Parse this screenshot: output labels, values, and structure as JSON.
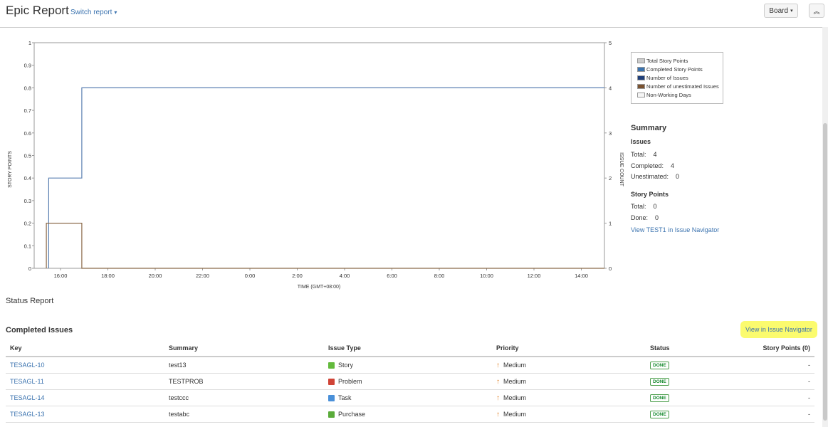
{
  "header": {
    "title": "Epic Report",
    "switch_report": "Switch report",
    "board_button": "Board",
    "collapse_icon": "double-chevron-up"
  },
  "chart_data": {
    "type": "line",
    "xlabel": "TIME (GMT+08:00)",
    "ylabel": "STORY POINTS",
    "y2label": "ISSUE COUNT",
    "x_ticks": [
      "16:00",
      "18:00",
      "20:00",
      "22:00",
      "0:00",
      "2:00",
      "4:00",
      "6:00",
      "8:00",
      "10:00",
      "12:00",
      "14:00"
    ],
    "y_ticks": [
      "0",
      "0.1",
      "0.2",
      "0.3",
      "0.4",
      "0.5",
      "0.6",
      "0.7",
      "0.8",
      "0.9",
      "1"
    ],
    "y2_ticks": [
      "0",
      "1",
      "2",
      "3",
      "4",
      "5"
    ],
    "ylim": [
      0,
      1
    ],
    "y2lim": [
      0,
      5
    ],
    "x_range_hours": [
      15,
      15.75
    ],
    "grid": false,
    "legend_placement": "right",
    "series": [
      {
        "name": "Number of Issues",
        "axis": "right",
        "color": "#5b80b2",
        "points": [
          [
            15.5,
            0
          ],
          [
            15.5,
            2
          ],
          [
            16.9,
            2
          ],
          [
            16.9,
            4
          ],
          [
            40.9,
            4
          ]
        ]
      },
      {
        "name": "Number of unestimated Issues",
        "axis": "right",
        "color": "#8b6a4a",
        "points": [
          [
            15.4,
            0
          ],
          [
            15.4,
            1
          ],
          [
            16.9,
            1
          ],
          [
            16.9,
            0
          ],
          [
            40.9,
            0
          ]
        ]
      },
      {
        "name": "Total Story Points",
        "axis": "left",
        "color": "#c8c8c8",
        "points": []
      },
      {
        "name": "Completed Story Points",
        "axis": "left",
        "color": "#5b9bd5",
        "points": []
      }
    ],
    "legend": [
      {
        "label": "Total Story Points",
        "color": "#cccccc"
      },
      {
        "label": "Completed Story Points",
        "color": "#3b73af"
      },
      {
        "label": "Number of Issues",
        "color": "#1f3f7a"
      },
      {
        "label": "Number of unestimated Issues",
        "color": "#7a5230"
      },
      {
        "label": "Non-Working Days",
        "color": "#f5f5f5"
      }
    ]
  },
  "summary": {
    "title": "Summary",
    "issues_heading": "Issues",
    "issues_total_label": "Total:",
    "issues_total": "4",
    "completed_label": "Completed:",
    "completed": "4",
    "unestimated_label": "Unestimated:",
    "unestimated": "0",
    "sp_heading": "Story Points",
    "sp_total_label": "Total:",
    "sp_total": "0",
    "sp_done_label": "Done:",
    "sp_done": "0",
    "link": "View TEST1 in Issue Navigator"
  },
  "status_report": {
    "label": "Status Report",
    "completed_heading": "Completed Issues",
    "view_link": "View in Issue Navigator"
  },
  "table": {
    "columns": [
      "Key",
      "Summary",
      "Issue Type",
      "Priority",
      "Status",
      "Story Points (0)"
    ],
    "rows": [
      {
        "key": "TESAGL-10",
        "summary": "test13",
        "type": "Story",
        "type_color": "#63ba3c",
        "priority": "Medium",
        "status": "DONE",
        "points": "-"
      },
      {
        "key": "TESAGL-11",
        "summary": "TESTPROB",
        "type": "Problem",
        "type_color": "#d04437",
        "priority": "Medium",
        "status": "DONE",
        "points": "-"
      },
      {
        "key": "TESAGL-14",
        "summary": "testccc",
        "type": "Task",
        "type_color": "#4a90d9",
        "priority": "Medium",
        "status": "DONE",
        "points": "-"
      },
      {
        "key": "TESAGL-13",
        "summary": "testabc",
        "type": "Purchase",
        "type_color": "#5aab3a",
        "priority": "Medium",
        "status": "DONE",
        "points": "-"
      }
    ]
  }
}
